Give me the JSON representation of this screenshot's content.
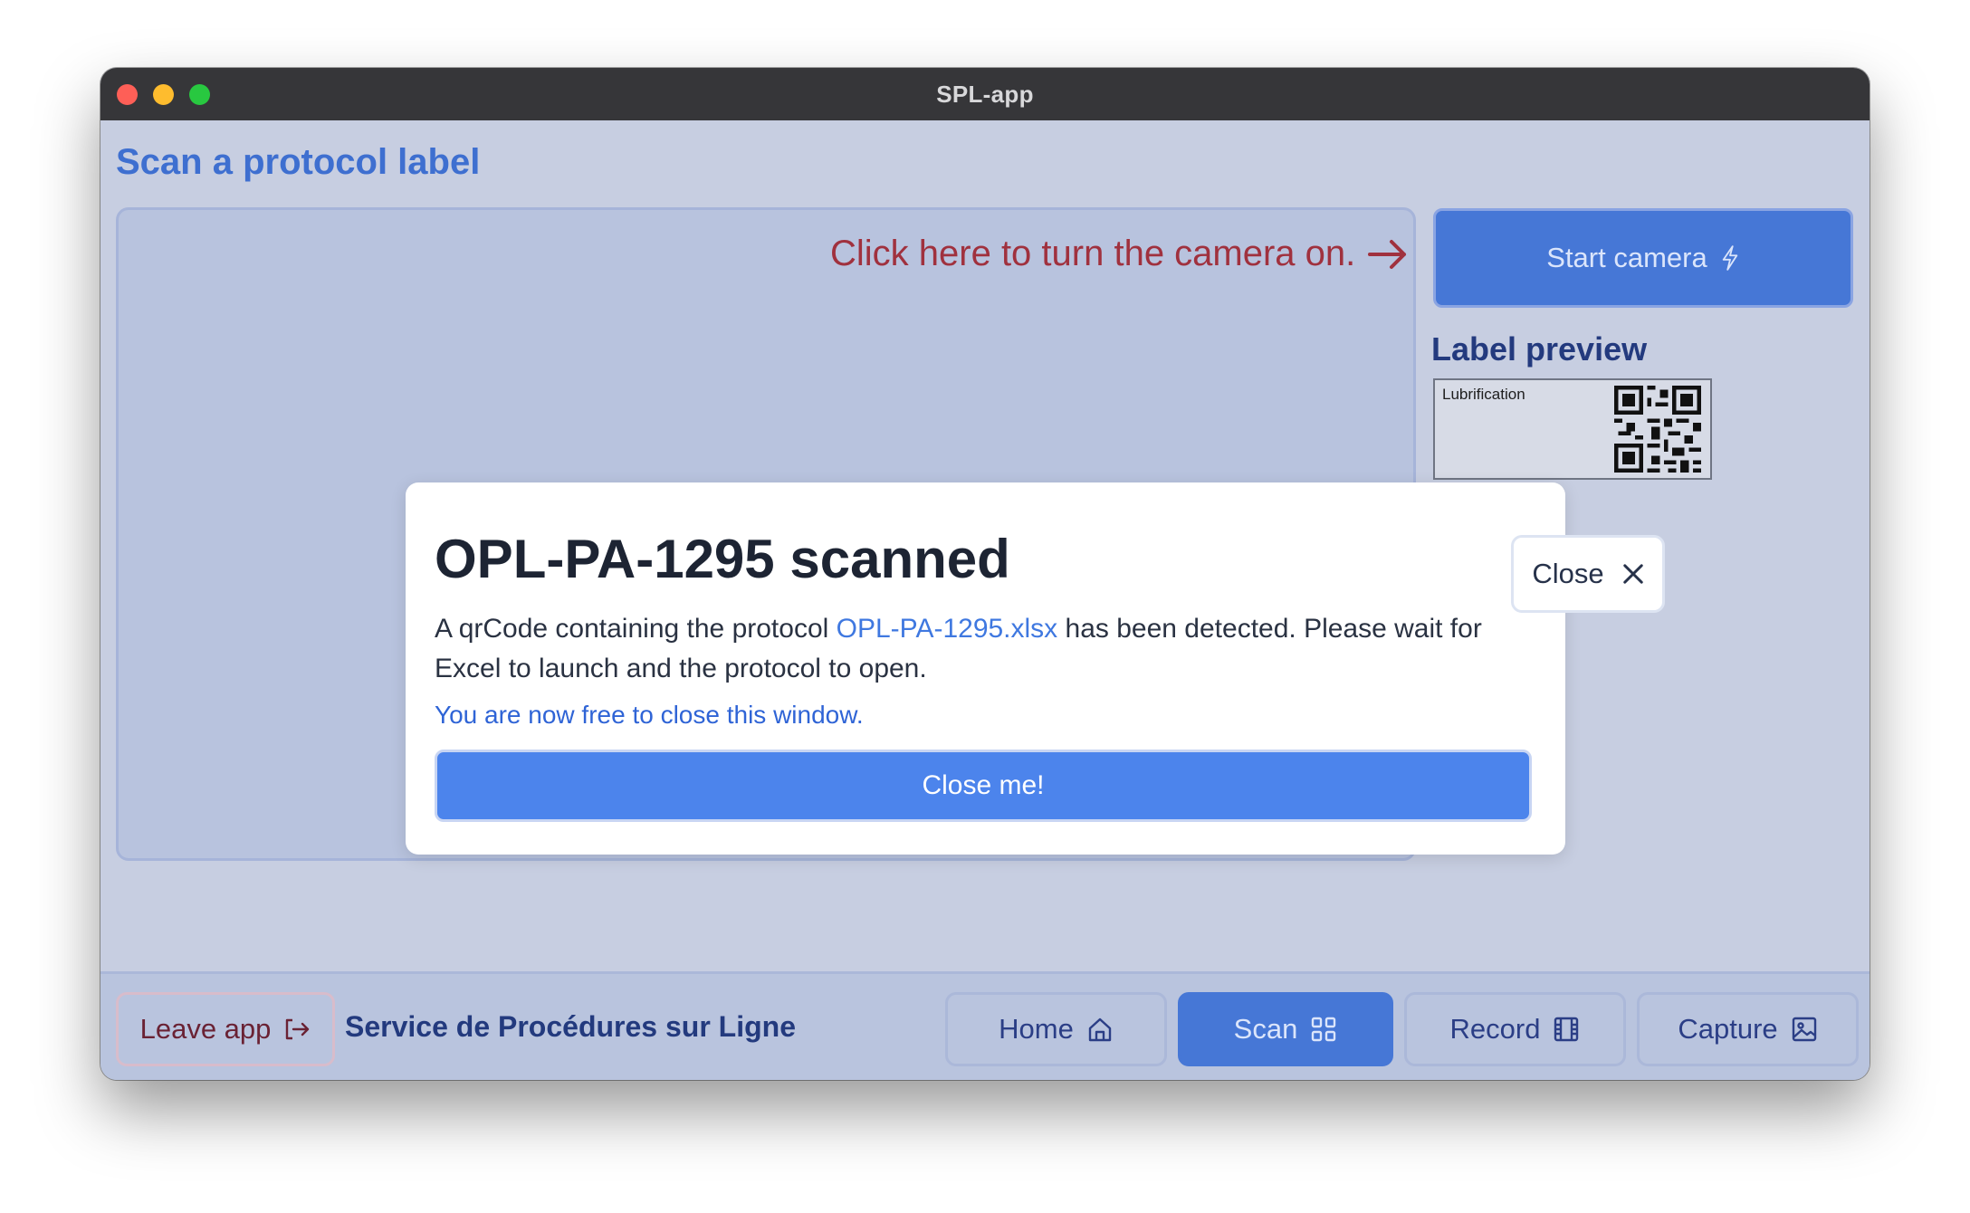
{
  "window": {
    "title": "SPL-app"
  },
  "page": {
    "title": "Scan a protocol label"
  },
  "camera": {
    "hint": "Click here to turn the camera on.",
    "start_label": "Start camera"
  },
  "preview": {
    "title": "Label preview",
    "label_text": "Lubrification"
  },
  "modal": {
    "heading": "OPL-PA-1295 scanned",
    "body_before": "A qrCode containing the protocol ",
    "body_link": "OPL-PA-1295.xlsx",
    "body_after": " has been detected. Please wait for Excel to launch and the protocol to open.",
    "note": "You are now free to close this window.",
    "button_label": "Close me!",
    "close_label": "Close"
  },
  "footer": {
    "leave_label": "Leave app",
    "brand": "Service de Procédures sur Ligne",
    "nav": {
      "home": "Home",
      "scan": "Scan",
      "record": "Record",
      "capture": "Capture"
    },
    "active_tab": "scan"
  },
  "colors": {
    "accent": "#4677d6",
    "hint": "#a0313e",
    "primary_button": "#4c84ec"
  }
}
